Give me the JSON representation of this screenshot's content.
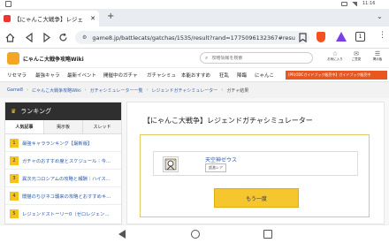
{
  "status_bar": {
    "time": "11:16"
  },
  "browser": {
    "tab_title": "【にゃんこ大戦争】レジェ",
    "new_tab": "+",
    "url": "game8.jp/battlecats/gatchas/1535/result?rand=1775096132367#resu",
    "tab_count": "1"
  },
  "site": {
    "name": "にゃんこ大戦争攻略Wiki",
    "search_placeholder": "攻略情報を検索",
    "icons": [
      {
        "label": "お気に入り"
      },
      {
        "label": "ご意見"
      },
      {
        "label": "掲示板"
      }
    ],
    "nav": [
      "リセマラ",
      "最強キャラ",
      "最新イベント",
      "開催中のガチャ",
      "ガチャシミュ",
      "本能おすすめ",
      "狂乱",
      "降臨",
      "にゃんこ"
    ],
    "promo": "(PR)ODCガイドブック販売中】ガイドブック販売中"
  },
  "breadcrumb": [
    "Game8",
    "にゃんこ大戦争攻略Wiki",
    "ガチャシミュレーター一覧",
    "レジェンドガチャシミュレーター",
    "ガチャ結果"
  ],
  "sidebar": {
    "title": "ランキング",
    "tabs": [
      "人気記事",
      "掲示板",
      "スレッド"
    ],
    "items": [
      {
        "rank": "1",
        "text": "最強キャラランキング【最新版】"
      },
      {
        "rank": "2",
        "text": "ガチャのおすすめ度とスケジュール｜今..."
      },
      {
        "rank": "3",
        "text": "異次元コロシアムの攻略と報酬｜ハイス..."
      },
      {
        "rank": "4",
        "text": "闇猫のちびネコ襲来の攻略とおすすめキ..."
      },
      {
        "rank": "5",
        "text": "レジェンドストーリー0（ゼロレジェン..."
      }
    ]
  },
  "main": {
    "title": "【にゃんこ大戦争】レジェンドガチャシミュレーター",
    "result": {
      "name": "天空神ゼウス",
      "rarity": "超激レア"
    },
    "again_button": "もう一度"
  },
  "colors": {
    "accent": "#f6c62e",
    "link": "#2a57a6",
    "header_dark": "#2f2f2f"
  }
}
